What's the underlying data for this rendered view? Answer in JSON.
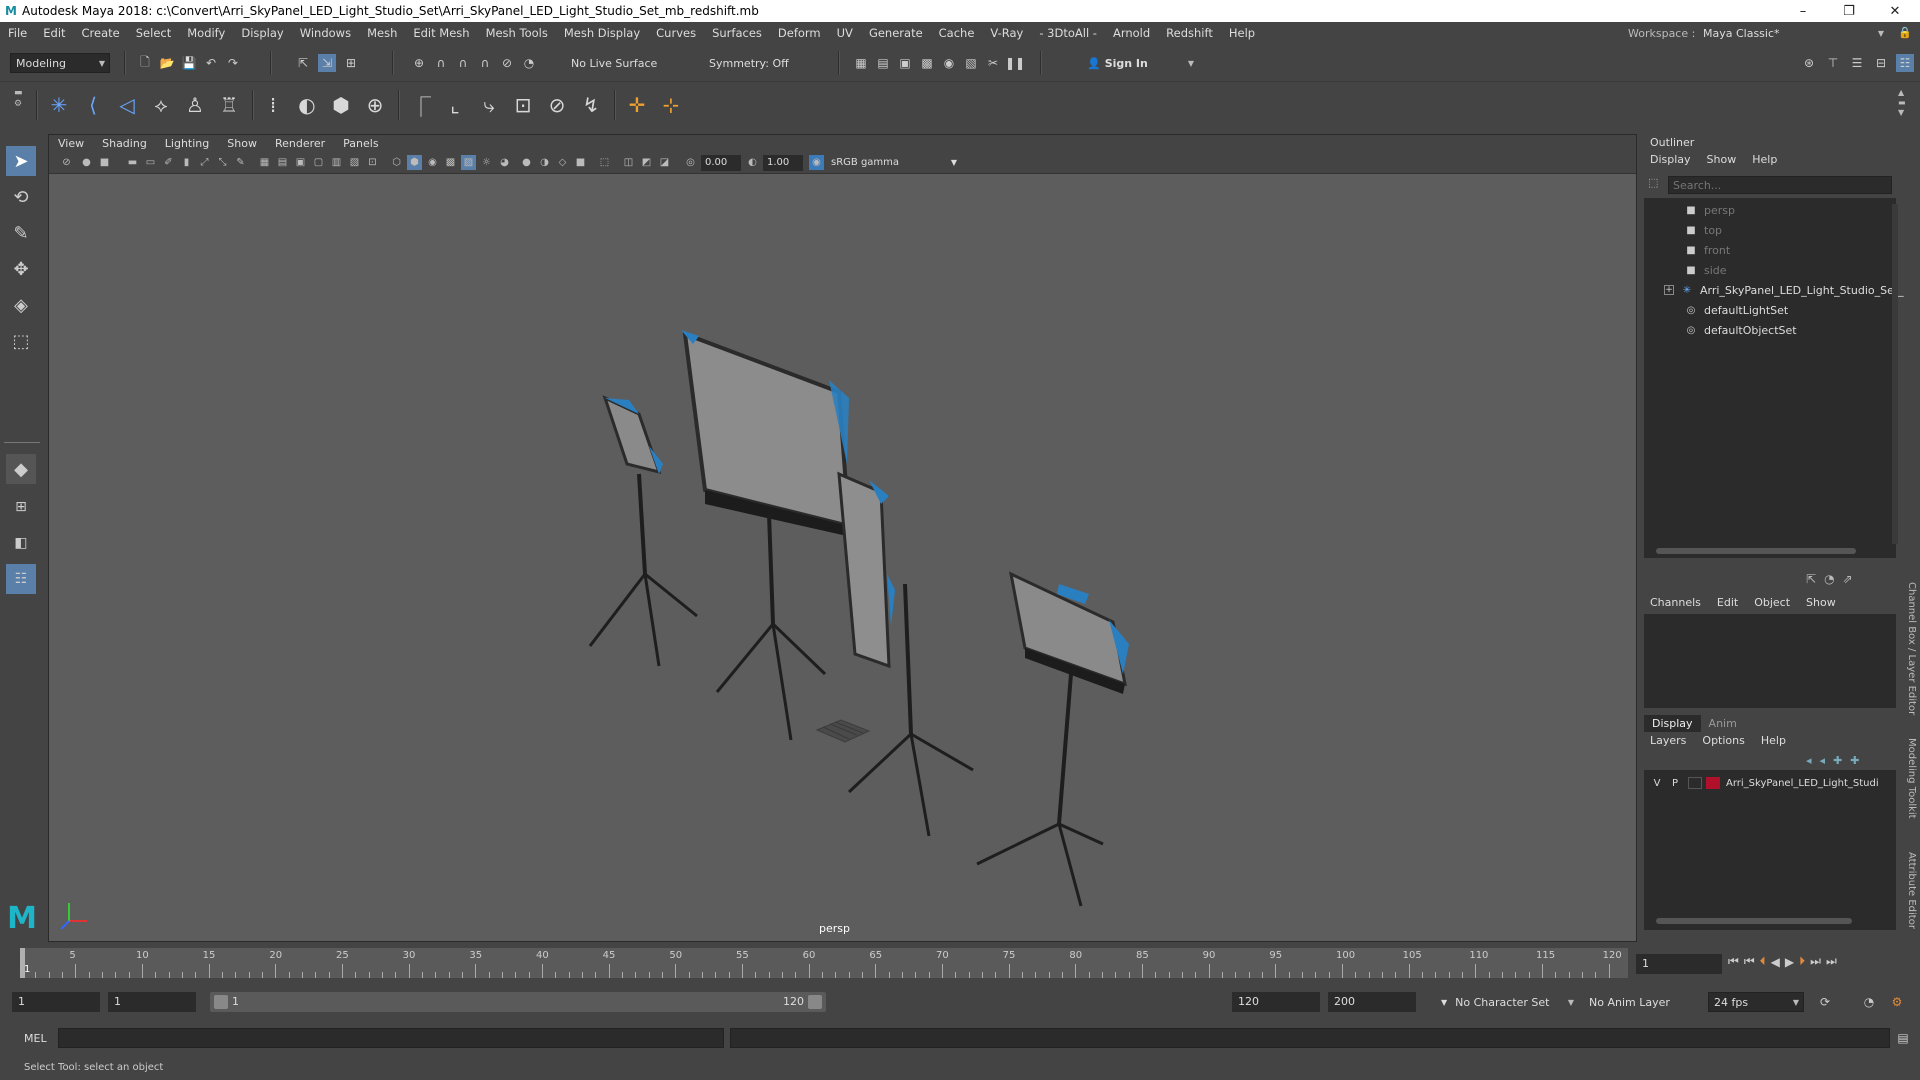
{
  "window": {
    "title": "Autodesk Maya 2018: c:\\Convert\\Arri_SkyPanel_LED_Light_Studio_Set\\Arri_SkyPanel_LED_Light_Studio_Set_mb_redshift.mb",
    "logo": "M",
    "minimize": "–",
    "maximize": "❐",
    "close": "✕"
  },
  "menubar": [
    "File",
    "Edit",
    "Create",
    "Select",
    "Modify",
    "Display",
    "Windows",
    "Mesh",
    "Edit Mesh",
    "Mesh Tools",
    "Mesh Display",
    "Curves",
    "Surfaces",
    "Deform",
    "UV",
    "Generate",
    "Cache",
    "V-Ray",
    "- 3DtoAll -",
    "Arnold",
    "Redshift",
    "Help"
  ],
  "workspace": {
    "label": "Workspace :",
    "value": "Maya Classic*"
  },
  "statusline": {
    "mode": "Modeling",
    "live_surface": "No Live Surface",
    "symmetry": "Symmetry: Off",
    "sign_in": "Sign In"
  },
  "viewport": {
    "menu": [
      "View",
      "Shading",
      "Lighting",
      "Show",
      "Renderer",
      "Panels"
    ],
    "exposure": "0.00",
    "gamma": "1.00",
    "color_space": "sRGB gamma",
    "camera": "persp"
  },
  "outliner": {
    "title": "Outliner",
    "menu": [
      "Display",
      "Show",
      "Help"
    ],
    "search_placeholder": "Search...",
    "items": [
      {
        "label": "persp",
        "dim": true,
        "icon": "camera-icon"
      },
      {
        "label": "top",
        "dim": true,
        "icon": "camera-icon"
      },
      {
        "label": "front",
        "dim": true,
        "icon": "camera-icon"
      },
      {
        "label": "side",
        "dim": true,
        "icon": "camera-icon"
      },
      {
        "label": "Arri_SkyPanel_LED_Light_Studio_Set_ncl",
        "dim": false,
        "icon": "group-icon"
      },
      {
        "label": "defaultLightSet",
        "dim": false,
        "icon": "set-icon"
      },
      {
        "label": "defaultObjectSet",
        "dim": false,
        "icon": "set-icon"
      }
    ]
  },
  "channelbox": {
    "menu": [
      "Channels",
      "Edit",
      "Object",
      "Show"
    ]
  },
  "layers": {
    "tabs": [
      "Display",
      "Anim"
    ],
    "menu": [
      "Layers",
      "Options",
      "Help"
    ],
    "row": {
      "v": "V",
      "p": "P",
      "name": "Arri_SkyPanel_LED_Light_Studi",
      "color": "#b0102a"
    }
  },
  "sidestrip": [
    "Channel Box / Layer Editor",
    "Modeling Toolkit",
    "Attribute Editor"
  ],
  "timeslider": {
    "labels": [
      "5",
      "10",
      "15",
      "20",
      "25",
      "30",
      "35",
      "40",
      "45",
      "50",
      "55",
      "60",
      "65",
      "70",
      "75",
      "80",
      "85",
      "90",
      "95",
      "100",
      "105",
      "110",
      "115",
      "120"
    ],
    "current": "1",
    "current_field": "1"
  },
  "rangeslider": {
    "start": "1",
    "playback_start": "1",
    "range_start": "1",
    "range_end": "120",
    "playback_end": "120",
    "end": "200",
    "character_set": "No Character Set",
    "anim_layer": "No Anim Layer",
    "fps": "24 fps"
  },
  "cmdline": {
    "label": "MEL"
  },
  "helpline": {
    "text": "Select Tool: select an object"
  }
}
